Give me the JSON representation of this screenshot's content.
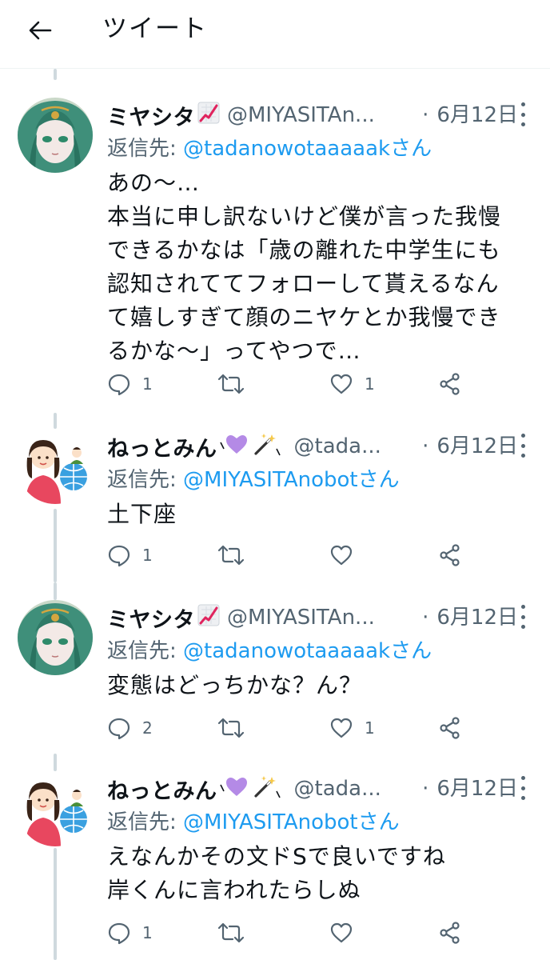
{
  "header": {
    "title": "ツイート"
  },
  "tweets": [
    {
      "name": "ミヤシタ",
      "handle": "@MIYASITAn...",
      "date": "6月12日",
      "reply_label": "返信先: ",
      "reply_mention": "@tadanowotaaaaak",
      "reply_suffix": "さん",
      "text": "あの〜…\n本当に申し訳ないけど僕が言った我慢できるかなは「歳の離れた中学生にも認知されててフォローして貰えるなんて嬉しすぎて顔のニヤケとか我慢できるかな〜」ってやつで…",
      "reply_count": "1",
      "retweet_count": "",
      "like_count": "1",
      "avatar": "green-hair-character-icon",
      "name_emoji": "chart-increasing-icon"
    },
    {
      "name": "ねっとみん",
      "handle": "@tada...",
      "date": "6月12日",
      "reply_label": "返信先: ",
      "reply_mention": "@MIYASITAnobot",
      "reply_suffix": "さん",
      "text": "土下座",
      "reply_count": "1",
      "retweet_count": "",
      "like_count": "",
      "avatar": "girl-with-globe-icon",
      "name_emoji": "purple-heart-magic-wand-icon"
    },
    {
      "name": "ミヤシタ",
      "handle": "@MIYASITAn...",
      "date": "6月12日",
      "reply_label": "返信先: ",
      "reply_mention": "@tadanowotaaaaak",
      "reply_suffix": "さん",
      "text": "変態はどっちかな？ん？",
      "reply_count": "2",
      "retweet_count": "",
      "like_count": "1",
      "avatar": "green-hair-character-icon",
      "name_emoji": "chart-increasing-icon"
    },
    {
      "name": "ねっとみん",
      "handle": "@tada...",
      "date": "6月12日",
      "reply_label": "返信先: ",
      "reply_mention": "@MIYASITAnobot",
      "reply_suffix": "さん",
      "text": "えなんかその文ドSで良いですね\n岸くんに言われたらしぬ",
      "reply_count": "1",
      "retweet_count": "",
      "like_count": "",
      "avatar": "girl-with-globe-icon",
      "name_emoji": "purple-heart-magic-wand-icon"
    }
  ],
  "colors": {
    "text": "#0f1419",
    "secondary": "#536471",
    "link": "#1d9bf0",
    "thread_line": "#cfd9de"
  }
}
